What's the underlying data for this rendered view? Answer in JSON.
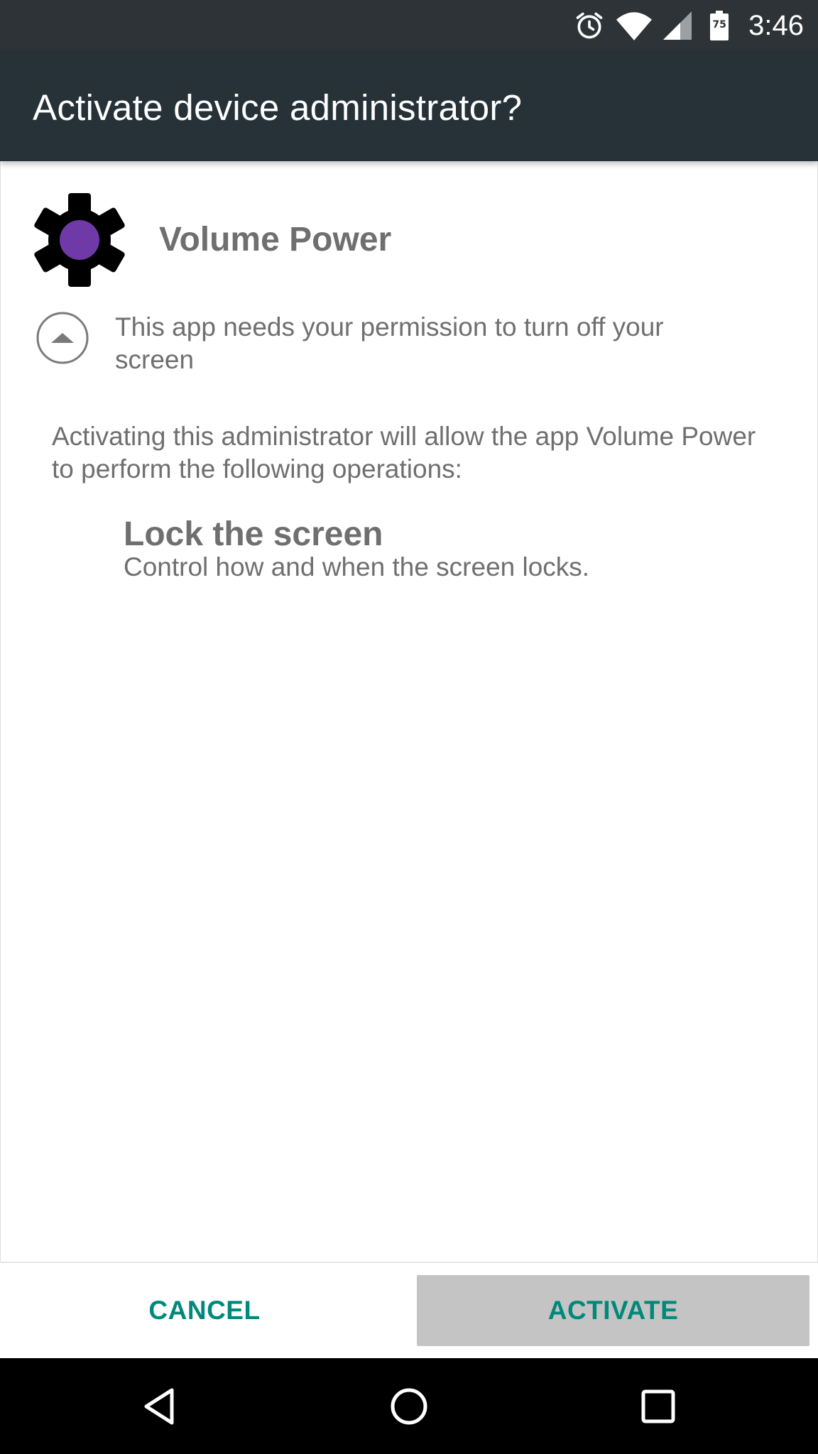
{
  "status_bar": {
    "time": "3:46",
    "battery_level": "75",
    "icons": [
      "alarm-icon",
      "wifi-icon",
      "signal-icon",
      "battery-icon"
    ]
  },
  "app_bar": {
    "title": "Activate device administrator?"
  },
  "app": {
    "name": "Volume Power",
    "icon": "gear-icon",
    "icon_accent": "#6f3aa8"
  },
  "permission": {
    "icon": "expand-collapse-icon",
    "text": "This app needs your permission to turn off your screen"
  },
  "description": "Activating this administrator will allow the app Volume Power to perform the following operations:",
  "policies": [
    {
      "title": "Lock the screen",
      "description": "Control how and when the screen locks."
    }
  ],
  "buttons": {
    "cancel": "CANCEL",
    "activate": "ACTIVATE"
  },
  "colors": {
    "accent": "#00897b",
    "app_bar": "#263238",
    "status_bar": "#2d3336"
  },
  "nav_bar": {
    "icons": [
      "back-icon",
      "home-icon",
      "recents-icon"
    ]
  }
}
